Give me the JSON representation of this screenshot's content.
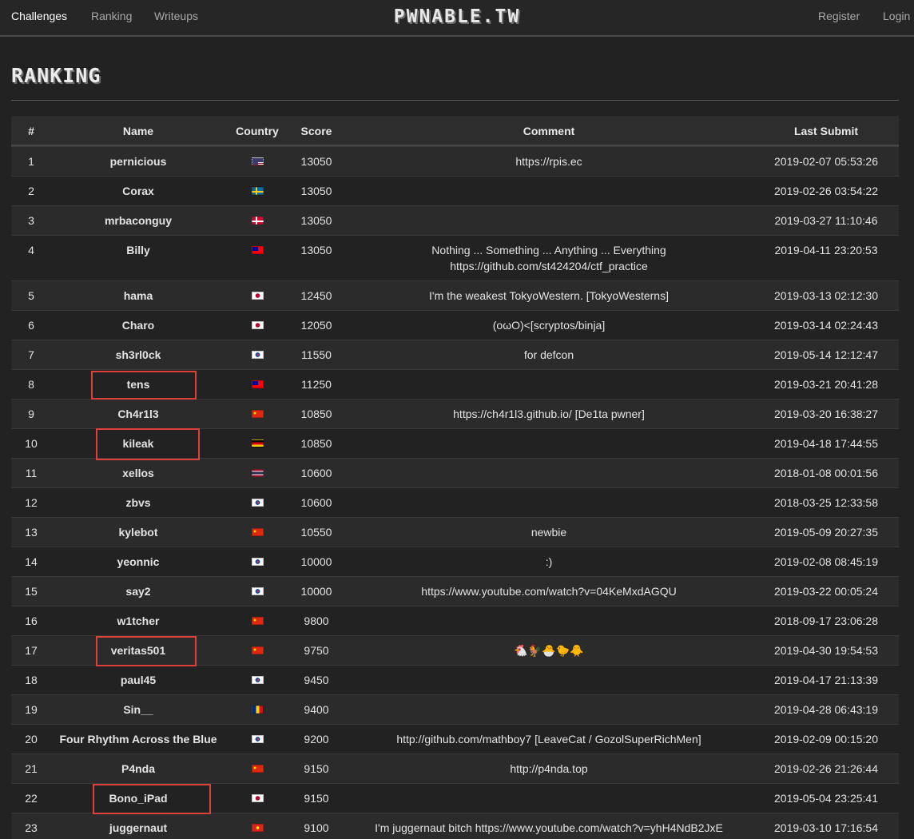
{
  "nav": {
    "links": [
      "Challenges",
      "Ranking",
      "Writeups"
    ],
    "brand": "PWNABLE.TW",
    "right_links": [
      "Register",
      "Login"
    ]
  },
  "page": {
    "title": "RANKING"
  },
  "table": {
    "headers": [
      "#",
      "Name",
      "Country",
      "Score",
      "Comment",
      "Last Submit"
    ],
    "rows": [
      {
        "rank": "1",
        "name": "pernicious",
        "country": "us",
        "score": "13050",
        "comment": "https://rpis.ec",
        "last": "2019-02-07 05:53:26"
      },
      {
        "rank": "2",
        "name": "Corax",
        "country": "se",
        "score": "13050",
        "comment": "",
        "last": "2019-02-26 03:54:22"
      },
      {
        "rank": "3",
        "name": "mrbaconguy",
        "country": "dk",
        "score": "13050",
        "comment": "",
        "last": "2019-03-27 11:10:46"
      },
      {
        "rank": "4",
        "name": "Billy",
        "country": "tw",
        "score": "13050",
        "comment": "Nothing ... Something ... Anything ... Everything https://github.com/st424204/ctf_practice",
        "last": "2019-04-11 23:20:53"
      },
      {
        "rank": "5",
        "name": "hama",
        "country": "jp",
        "score": "12450",
        "comment": "I'm the weakest TokyoWestern. [TokyoWesterns]",
        "last": "2019-03-13 02:12:30"
      },
      {
        "rank": "6",
        "name": "Charo",
        "country": "jp",
        "score": "12050",
        "comment": "(oωO)<[scryptos/binja]",
        "last": "2019-03-14 02:24:43"
      },
      {
        "rank": "7",
        "name": "sh3rl0ck",
        "country": "kr",
        "score": "11550",
        "comment": "for defcon",
        "last": "2019-05-14 12:12:47"
      },
      {
        "rank": "8",
        "name": "tens",
        "country": "tw",
        "score": "11250",
        "comment": "",
        "last": "2019-03-21 20:41:28"
      },
      {
        "rank": "9",
        "name": "Ch4r1l3",
        "country": "cn",
        "score": "10850",
        "comment": "https://ch4r1l3.github.io/ [De1ta pwner]",
        "last": "2019-03-20 16:38:27"
      },
      {
        "rank": "10",
        "name": "kileak",
        "country": "de",
        "score": "10850",
        "comment": "",
        "last": "2019-04-18 17:44:55"
      },
      {
        "rank": "11",
        "name": "xellos",
        "country": "th",
        "score": "10600",
        "comment": "",
        "last": "2018-01-08 00:01:56"
      },
      {
        "rank": "12",
        "name": "zbvs",
        "country": "kr",
        "score": "10600",
        "comment": "",
        "last": "2018-03-25 12:33:58"
      },
      {
        "rank": "13",
        "name": "kylebot",
        "country": "cn",
        "score": "10550",
        "comment": "newbie",
        "last": "2019-05-09 20:27:35"
      },
      {
        "rank": "14",
        "name": "yeonnic",
        "country": "kr",
        "score": "10000",
        "comment": ":)",
        "last": "2019-02-08 08:45:19"
      },
      {
        "rank": "15",
        "name": "say2",
        "country": "kr",
        "score": "10000",
        "comment": "https://www.youtube.com/watch?v=04KeMxdAGQU",
        "last": "2019-03-22 00:05:24"
      },
      {
        "rank": "16",
        "name": "w1tcher",
        "country": "cn",
        "score": "9800",
        "comment": "",
        "last": "2018-09-17 23:06:28"
      },
      {
        "rank": "17",
        "name": "veritas501",
        "country": "cn",
        "score": "9750",
        "comment": "🐔🐓🐣🐤🐥",
        "last": "2019-04-30 19:54:53"
      },
      {
        "rank": "18",
        "name": "paul45",
        "country": "kr",
        "score": "9450",
        "comment": "",
        "last": "2019-04-17 21:13:39"
      },
      {
        "rank": "19",
        "name": "Sin__",
        "country": "ro",
        "score": "9400",
        "comment": "",
        "last": "2019-04-28 06:43:19"
      },
      {
        "rank": "20",
        "name": "Four Rhythm Across the Blue",
        "country": "kr",
        "score": "9200",
        "comment": "http://github.com/mathboy7 [LeaveCat / GozolSuperRichMen]",
        "last": "2019-02-09 00:15:20"
      },
      {
        "rank": "21",
        "name": "P4nda",
        "country": "cn",
        "score": "9150",
        "comment": "http://p4nda.top",
        "last": "2019-02-26 21:26:44"
      },
      {
        "rank": "22",
        "name": "Bono_iPad",
        "country": "jp",
        "score": "9150",
        "comment": "",
        "last": "2019-05-04 23:25:41"
      },
      {
        "rank": "23",
        "name": "juggernaut",
        "country": "vn",
        "score": "9100",
        "comment": "I'm juggernaut bitch https://www.youtube.com/watch?v=yhH4NdB2JxE",
        "last": "2019-03-10 17:16:54"
      }
    ]
  },
  "highlighted_ranks": [
    "7",
    "9",
    "16",
    "21"
  ],
  "colors": {
    "background": "#222222",
    "highlight": "#e0403a"
  }
}
